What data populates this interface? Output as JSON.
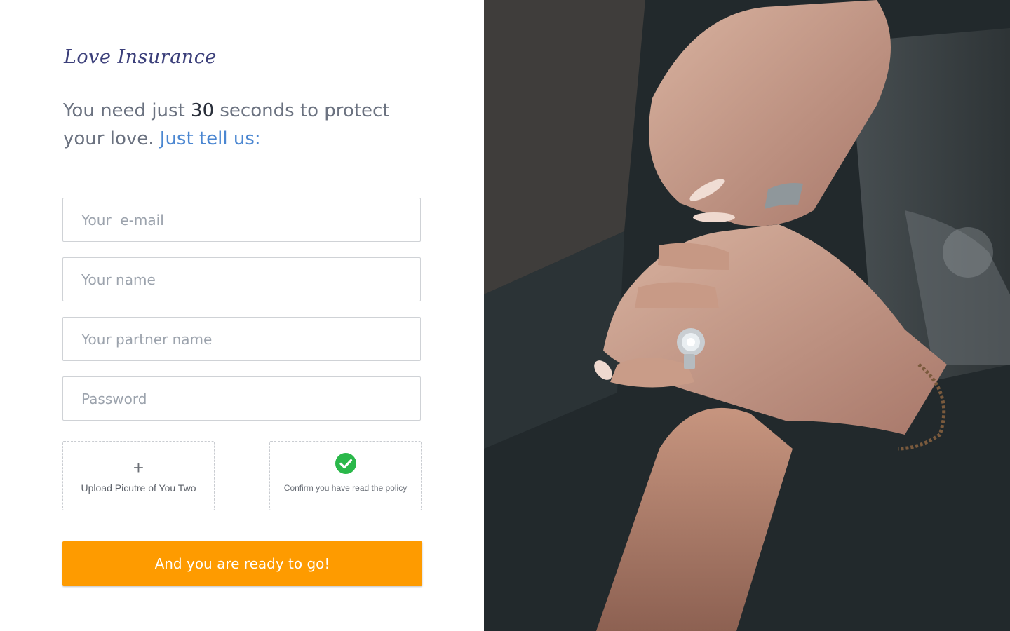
{
  "brand": {
    "logo_text": "Love Insurance"
  },
  "headline": {
    "part1": "You need just ",
    "number": "30",
    "part2": " seconds to protect your love. ",
    "highlight": "Just tell us:"
  },
  "form": {
    "email_placeholder": "Your  e-mail",
    "name_placeholder": "Your name",
    "partner_placeholder": "Your partner name",
    "password_placeholder": "Password",
    "upload_label": "Upload Picutre of You Two",
    "upload_icon": "plus-icon",
    "policy_label": "Confirm you have read the policy",
    "policy_icon": "check-circle-icon",
    "policy_confirmed": true,
    "submit_label": "And you are ready to go!"
  },
  "colors": {
    "accent_orange": "#fe9b00",
    "highlight_blue": "#4a86d1",
    "logo_navy": "#3b3f7a",
    "check_green": "#2ab84a"
  },
  "hero_image": {
    "subject": "couple holding hands with engagement ring"
  }
}
